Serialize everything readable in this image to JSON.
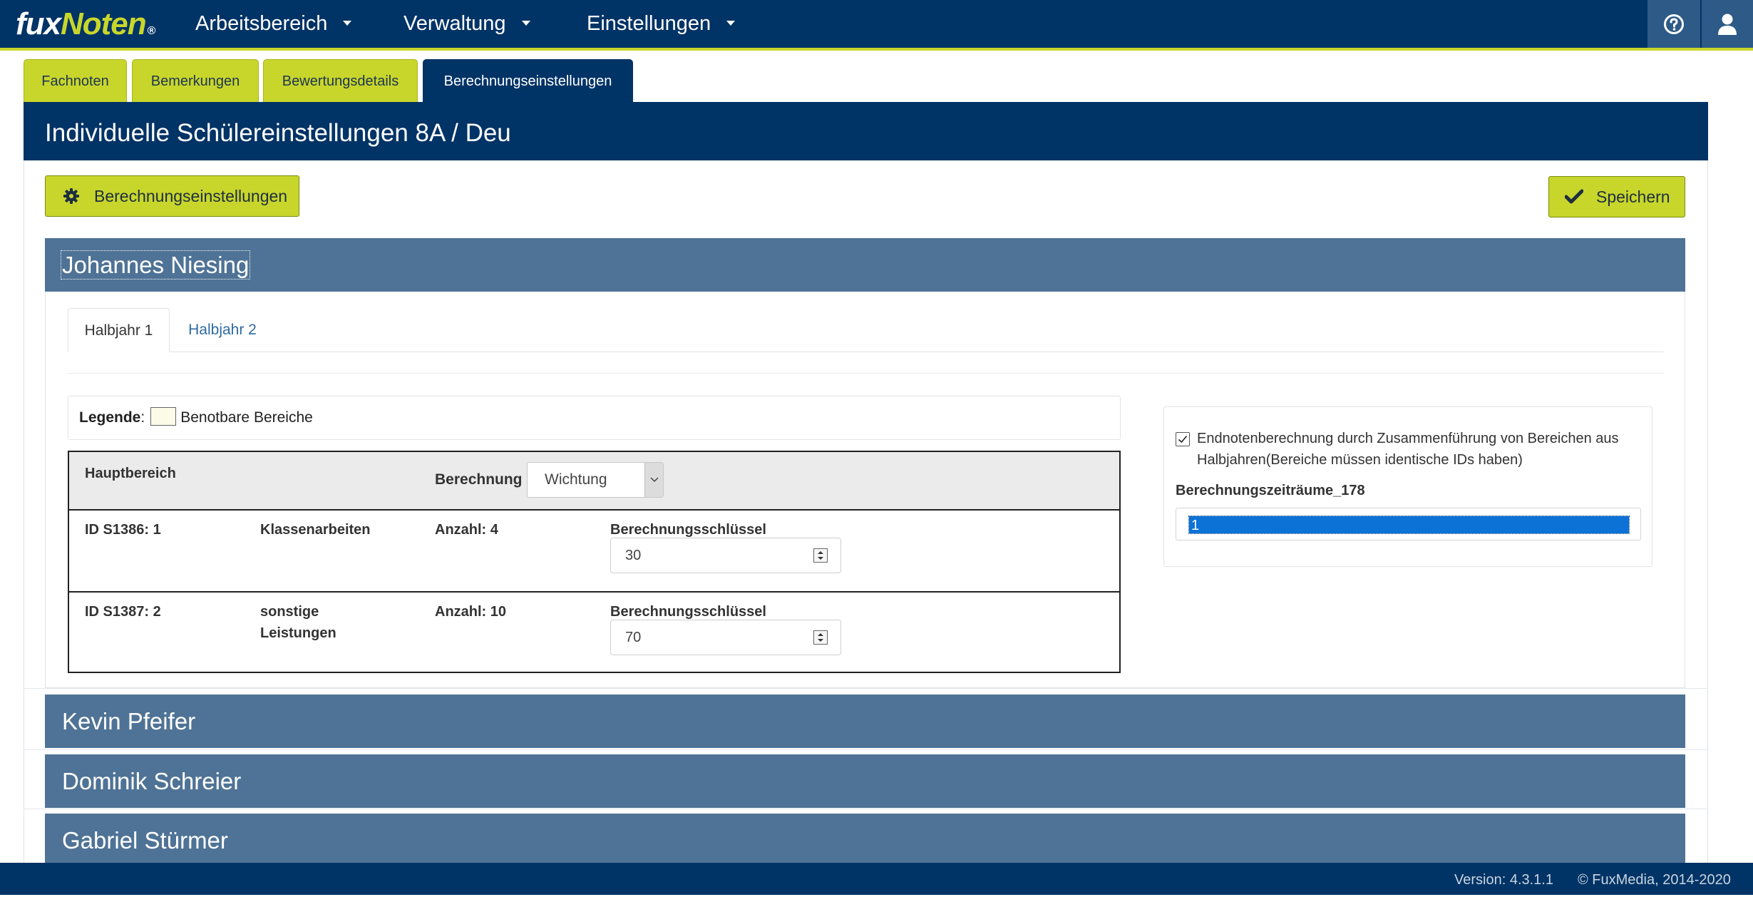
{
  "app": {
    "logo_part1": "fux",
    "logo_part2": "Noten",
    "logo_mark": "®"
  },
  "nav": {
    "items": [
      {
        "label": "Arbeitsbereich"
      },
      {
        "label": "Verwaltung"
      },
      {
        "label": "Einstellungen"
      }
    ],
    "icons": [
      "help-icon",
      "user-icon"
    ]
  },
  "tabs": [
    {
      "label": "Fachnoten",
      "active": false
    },
    {
      "label": "Bemerkungen",
      "active": false
    },
    {
      "label": "Bewertungsdetails",
      "active": false
    },
    {
      "label": "Berechnungseinstellungen",
      "active": true
    }
  ],
  "page": {
    "title": "Individuelle Schülereinstellungen 8A / Deu",
    "settings_button": "Berechnungseinstellungen",
    "save_button": "Speichern"
  },
  "students": [
    {
      "name": "Johannes Niesing",
      "expanded": true
    },
    {
      "name": "Kevin Pfeifer",
      "expanded": false
    },
    {
      "name": "Dominik Schreier",
      "expanded": false
    },
    {
      "name": "Gabriel Stürmer",
      "expanded": false
    }
  ],
  "halbjahr_tabs": [
    {
      "label": "Halbjahr 1",
      "active": true
    },
    {
      "label": "Halbjahr 2",
      "active": false
    }
  ],
  "legend": {
    "label": "Legende",
    "separator": ":",
    "item": "Benotbare Bereiche"
  },
  "calc_table": {
    "header": {
      "hauptbereich": "Hauptbereich",
      "berechnung_label": "Berechnung",
      "berechnung_value": "Wichtung"
    },
    "rows": [
      {
        "id": "ID S1386: 1",
        "name_line1": "Klassenarbeiten",
        "name_line2": "",
        "anzahl": "Anzahl: 4",
        "key_label": "Berechnungsschlüssel",
        "key_value": "30"
      },
      {
        "id": "ID S1387: 2",
        "name_line1": "sonstige",
        "name_line2": "Leistungen",
        "anzahl": "Anzahl: 10",
        "key_label": "Berechnungsschlüssel",
        "key_value": "70"
      }
    ]
  },
  "side": {
    "checkbox_checked": true,
    "checkbox_line1": "Endnotenberechnung durch Zusammenführung von Bereichen aus",
    "checkbox_line2": "Halbjahren(Bereiche müssen identische IDs haben)",
    "list_label": "Berechnungszeiträume_178",
    "list_selected": "1"
  },
  "footer": {
    "version": "Version: 4.3.1.1",
    "copyright": "© FuxMedia, 2014-2020"
  },
  "colors": {
    "brand_dark": "#003366",
    "accent_green": "#c8d62b",
    "student_header": "#4f7396",
    "selection_blue": "#0d72d6"
  }
}
